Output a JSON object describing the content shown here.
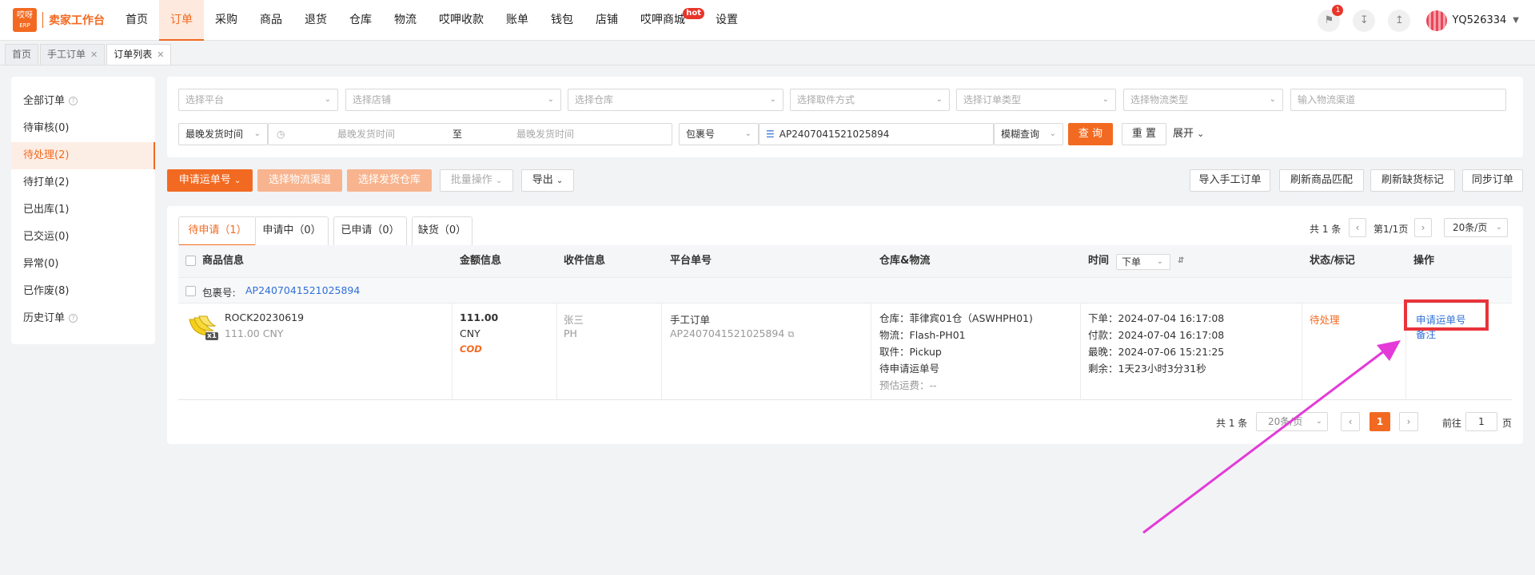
{
  "logo": {
    "box_top": "哎呀",
    "box_bottom": "ERP",
    "name": "卖家工作台"
  },
  "nav": [
    "首页",
    "订单",
    "采购",
    "商品",
    "退货",
    "仓库",
    "物流",
    "哎呷收款",
    "账单",
    "钱包",
    "店铺",
    "哎呷商城",
    "设置"
  ],
  "nav_hot_label": "hot",
  "notification_count": "1",
  "user": {
    "name": "YQ526334"
  },
  "window_tabs": [
    "首页",
    "手工订单",
    "订单列表"
  ],
  "left_menu": [
    "全部订单",
    "待审核(0)",
    "待处理(2)",
    "待打单(2)",
    "已出库(1)",
    "已交运(0)",
    "异常(0)",
    "已作废(8)",
    "历史订单"
  ],
  "filters": {
    "row1": [
      "选择平台",
      "选择店铺",
      "选择仓库",
      "选择取件方式",
      "选择订单类型",
      "选择物流类型",
      "输入物流渠道"
    ],
    "date_type": "最晚发货时间",
    "date_start": "最晚发货时间",
    "date_to": "至",
    "date_end": "最晚发货时间",
    "search_field": "包裹号",
    "search_value": "AP2407041521025894",
    "match_mode": "模糊查询",
    "query_btn": "查 询",
    "reset_btn": "重 置",
    "expand_btn": "展开"
  },
  "actions": {
    "apply_waybill": "申请运单号",
    "choose_channel": "选择物流渠道",
    "choose_warehouse": "选择发货仓库",
    "batch": "批量操作",
    "export": "导出",
    "import_manual": "导入手工订单",
    "refresh_match": "刷新商品匹配",
    "refresh_stockout": "刷新缺货标记",
    "sync_orders": "同步订单"
  },
  "sub_tabs": [
    "待申请（1）",
    "申请中（0）",
    "已申请（0）",
    "缺货（0）"
  ],
  "pager_top": {
    "total": "共 1 条",
    "page": "第1/1页",
    "per_page": "20条/页"
  },
  "columns": [
    "商品信息",
    "金额信息",
    "收件信息",
    "平台单号",
    "仓库&物流",
    "时间",
    "状态/标记",
    "操作"
  ],
  "time_sort": "下单",
  "package": {
    "label": "包裹号:",
    "id": "AP2407041521025894"
  },
  "order": {
    "sku": "ROCK20230619",
    "qty": "x1",
    "price": "111.00 CNY",
    "amount": "111.00",
    "currency": "CNY",
    "payment": "COD",
    "recipient_name": "张三",
    "recipient_country": "PH",
    "platform_type": "手工订单",
    "platform_no": "AP2407041521025894",
    "warehouse": "仓库：菲律宾01仓（ASWHPH01)",
    "logistics": "物流：Flash-PH01",
    "pickup": "取件：Pickup",
    "waybill_status": "待申请运单号",
    "freight": "预估运费：--",
    "time_order": "下单：2024-07-04 16:17:08",
    "time_paid": "付款：2024-07-04 16:17:08",
    "time_latest": "最晚：2024-07-06 15:21:25",
    "time_left": "剩余：1天23小时3分31秒",
    "status": "待处理",
    "op_apply": "申请运单号",
    "op_note": "备注"
  },
  "pager_bottom": {
    "total": "共 1 条",
    "per_page": "20条/页",
    "current": "1",
    "goto_prefix": "前往",
    "goto_value": "1",
    "goto_suffix": "页"
  },
  "colors": {
    "accent": "#f26a21",
    "annotation": "#e8343a",
    "arrow": "#e43ad8",
    "link": "#2f6fd6"
  }
}
